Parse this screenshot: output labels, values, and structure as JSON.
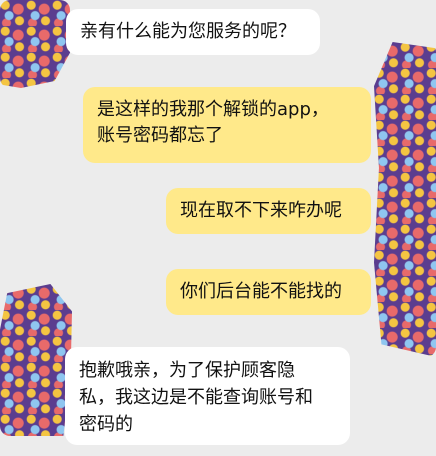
{
  "messages": [
    {
      "side": "incoming",
      "lines": [
        "亲有什么能为您服务的呢？"
      ]
    },
    {
      "side": "outgoing",
      "lines": [
        "是这样的我那个解锁的app，",
        "账号密码都忘了"
      ]
    },
    {
      "side": "outgoing",
      "lines": [
        "现在取不下来咋办呢"
      ]
    },
    {
      "side": "outgoing",
      "lines": [
        "你们后台能不能找的"
      ]
    },
    {
      "side": "incoming",
      "lines": [
        "抱歉哦亲，为了保护顾客隐",
        "私，我这边是不能查询账号和",
        "密码的"
      ]
    }
  ],
  "colors": {
    "background": "#ececec",
    "incoming_bubble": "#ffffff",
    "outgoing_bubble": "#ffe98a",
    "avatar": "#5b3d8f"
  }
}
